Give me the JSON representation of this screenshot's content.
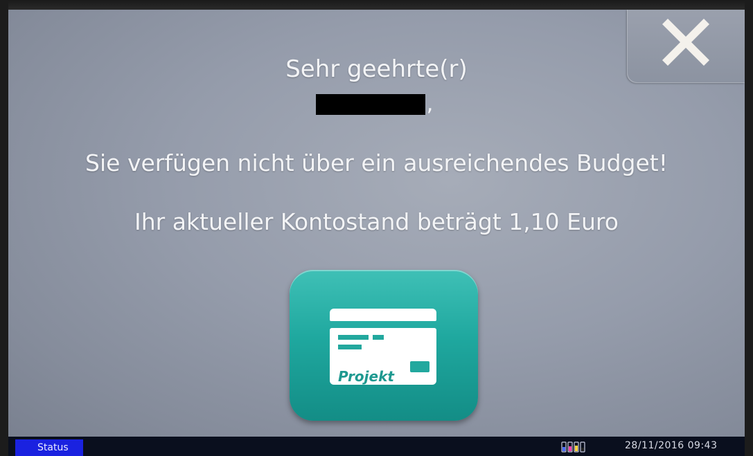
{
  "dialog": {
    "greeting": "Sehr geehrte(r)",
    "name_suffix": ",",
    "budget_message": "Sie verfügen nicht über ein ausreichendes Budget!",
    "balance_message": "Ihr aktueller Kontostand beträgt 1,10 Euro",
    "close_icon": "close-icon"
  },
  "project_button": {
    "label": "Projekt",
    "icon": "project-card-icon",
    "accent_color": "#1fa89f"
  },
  "statusbar": {
    "status_label": "Status",
    "toner_icon": "toner-icon",
    "datetime": "28/11/2016 09:43",
    "status_color": "#1a22e0"
  }
}
